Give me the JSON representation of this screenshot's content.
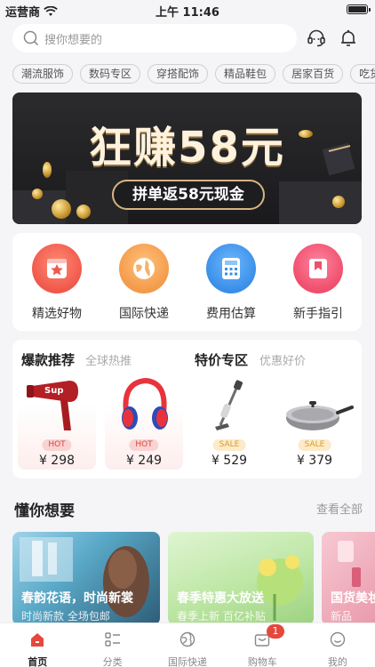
{
  "status_bar": {
    "carrier": "运营商",
    "time": "上午 11:46"
  },
  "search": {
    "placeholder": "搜你想要的"
  },
  "header_icons": [
    "customer-service-icon",
    "bell-icon"
  ],
  "categories": [
    "潮流服饰",
    "数码专区",
    "穿搭配饰",
    "精品鞋包",
    "居家百货",
    "吃货乐园"
  ],
  "banner": {
    "title": "狂赚58元",
    "subtitle": "拼单返58元现金"
  },
  "quick_entries": [
    {
      "label": "精选好物",
      "icon": "star-icon",
      "color": "#f0584c"
    },
    {
      "label": "国际快递",
      "icon": "globe-icon",
      "color": "#f39a4a"
    },
    {
      "label": "费用估算",
      "icon": "calculator-icon",
      "color": "#3a8ee8"
    },
    {
      "label": "新手指引",
      "icon": "bookmark-icon",
      "color": "#ef4e6c"
    }
  ],
  "hot_section": {
    "title": "爆款推荐",
    "subtitle": "全球热推",
    "items": [
      {
        "name": "hair-dryer",
        "badge": "HOT",
        "price": "¥ 298"
      },
      {
        "name": "headphones",
        "badge": "HOT",
        "price": "¥ 249"
      }
    ]
  },
  "special_section": {
    "title": "特价专区",
    "subtitle": "优惠好价",
    "items": [
      {
        "name": "vacuum-cleaner",
        "badge": "SALE",
        "price": "¥ 529"
      },
      {
        "name": "wok-pan",
        "badge": "SALE",
        "price": "¥ 379"
      }
    ]
  },
  "guess_section": {
    "title": "懂你想要",
    "see_all": "查看全部",
    "tiles": [
      {
        "title": "春韵花语，时尚新裳",
        "subtitle": "时尚新款 全场包邮"
      },
      {
        "title": "春季特惠大放送",
        "subtitle": "春季上新 百亿补贴"
      },
      {
        "title": "国货美妆",
        "subtitle": "新品"
      }
    ]
  },
  "tabbar": {
    "tabs": [
      {
        "label": "首页",
        "icon": "home-icon",
        "active": true
      },
      {
        "label": "分类",
        "icon": "category-icon",
        "active": false
      },
      {
        "label": "国际快递",
        "icon": "globe-icon",
        "active": false
      },
      {
        "label": "购物车",
        "icon": "cart-icon",
        "active": false
      },
      {
        "label": "我的",
        "icon": "profile-icon",
        "active": false
      }
    ],
    "cart_count": "1"
  },
  "colors": {
    "accent": "#e5483c",
    "background": "#f5f5f7"
  }
}
